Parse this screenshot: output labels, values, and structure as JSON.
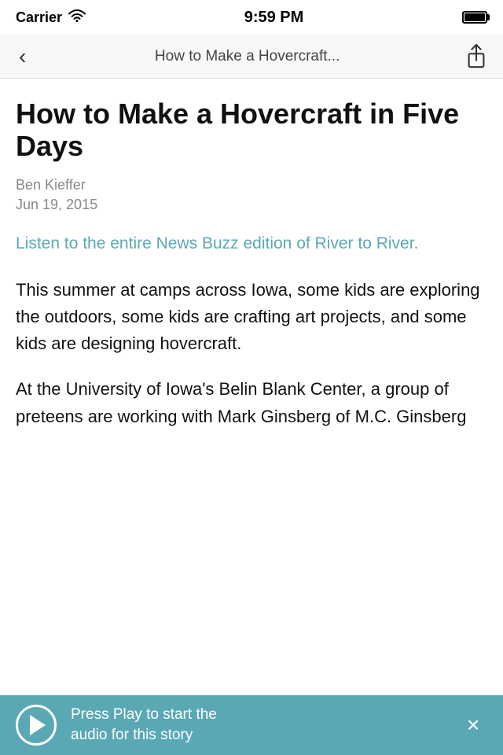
{
  "status_bar": {
    "carrier": "Carrier",
    "time": "9:59 PM"
  },
  "nav": {
    "title": "How to Make a Hovercraft...",
    "back_label": "‹",
    "share_label": "Share"
  },
  "article": {
    "title": "How to Make a Hovercraft in Five Days",
    "author": "Ben Kieffer",
    "date": "Jun 19, 2015",
    "link_text": "Listen to the entire News Buzz edition of River to River.",
    "link_url": "#",
    "body_paragraphs": [
      "This summer at camps across Iowa, some kids are exploring the outdoors, some kids are crafting art projects, and some kids are designing hovercraft.",
      "At the University of Iowa's Belin Blank Center, a group of preteens are working with Mark Ginsberg of M.C. Ginsberg"
    ]
  },
  "audio_bar": {
    "play_label": "Play",
    "text_line1": "Press Play to start the",
    "text_line2": "audio for this story",
    "close_label": "×"
  }
}
